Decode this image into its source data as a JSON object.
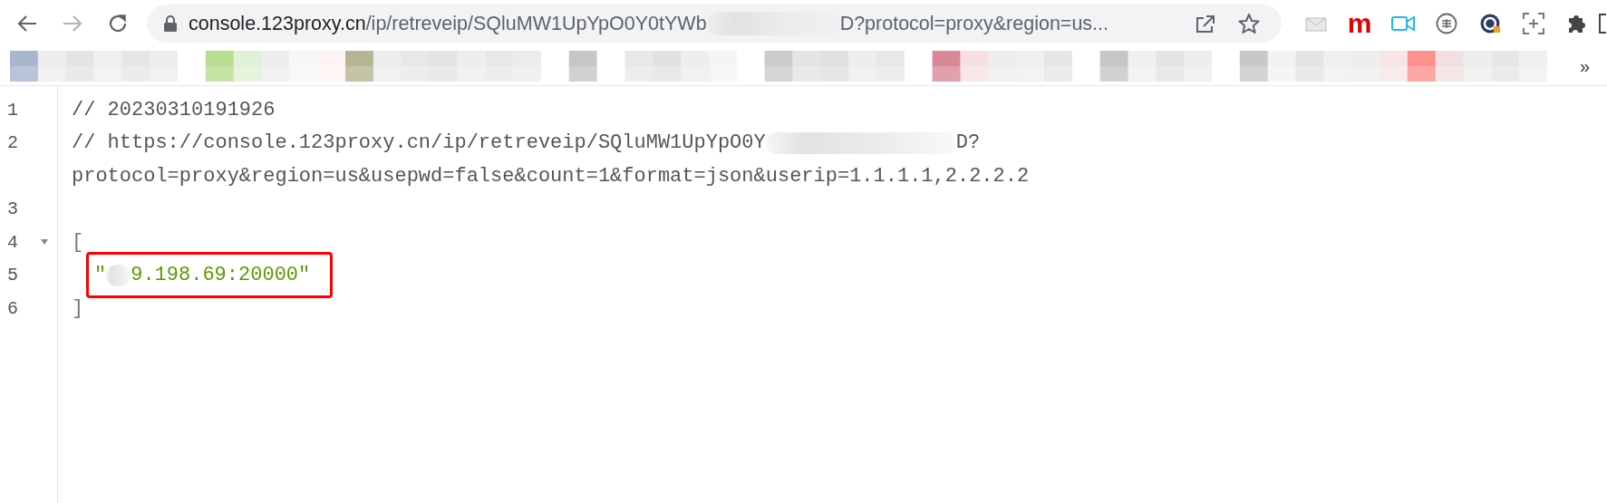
{
  "address_bar": {
    "url_parts": [
      {
        "kind": "host",
        "text": "console.123proxy.cn"
      },
      {
        "kind": "path",
        "text": "/ip/retreveip/SQluMW1UpYpO0Y0tYWb"
      },
      {
        "kind": "redacted"
      },
      {
        "kind": "path",
        "text": "D?protocol=proxy&region=us..."
      }
    ]
  },
  "extensions": [
    {
      "kind": "mail"
    },
    {
      "kind": "letter",
      "text": "m"
    },
    {
      "kind": "camera"
    },
    {
      "kind": "circle"
    },
    {
      "kind": "g"
    },
    {
      "kind": "scan"
    },
    {
      "kind": "puzzle"
    },
    {
      "kind": "panel"
    }
  ],
  "bookmarks_bar": {
    "overflow": "»"
  },
  "code_lines": [
    {
      "number": "1",
      "highlighted": false,
      "segments": [
        {
          "kind": "comment",
          "text": "// 20230310191926"
        }
      ]
    },
    {
      "number": "2",
      "highlighted": false,
      "segments": [
        {
          "kind": "comment",
          "text": "// https://console.123proxy.cn/ip/retreveip/SQluMW1UpYpO0Y"
        },
        {
          "kind": "redacted"
        },
        {
          "kind": "comment",
          "text": "D?"
        }
      ],
      "wrap": "protocol=proxy&region=us&usepwd=false&count=1&format=json&userip=1.1.1.1,2.2.2.2"
    },
    {
      "number": "3",
      "highlighted": false
    },
    {
      "number": "4",
      "expanded": true,
      "highlighted": false,
      "segments": [
        {
          "kind": "punct",
          "text": "["
        }
      ]
    },
    {
      "number": "5",
      "highlighted": true,
      "indent": true,
      "segments": [
        {
          "kind": "string",
          "text": "\""
        },
        {
          "kind": "redacted"
        },
        {
          "kind": "string",
          "text": "9.198.69:20000\""
        }
      ]
    },
    {
      "number": "6",
      "highlighted": false,
      "segments": [
        {
          "kind": "punct",
          "text": "]"
        }
      ]
    }
  ]
}
